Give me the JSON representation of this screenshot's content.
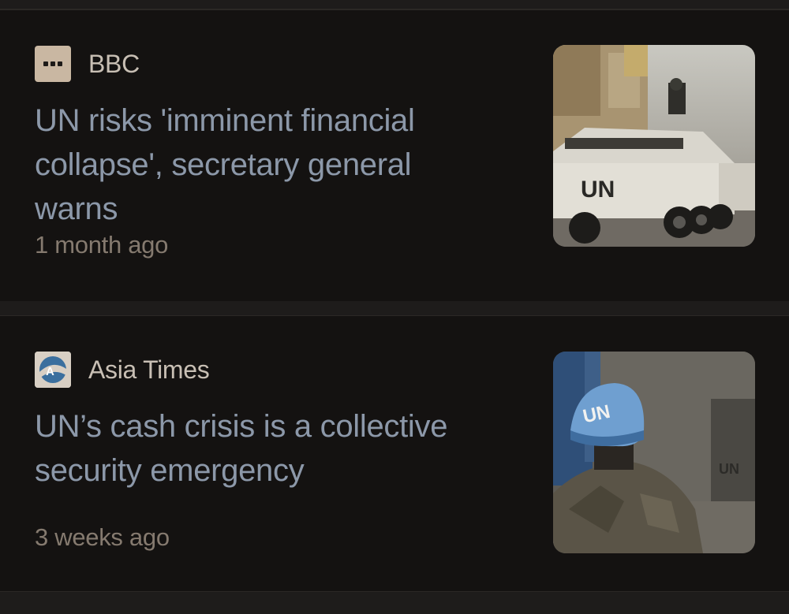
{
  "articles": [
    {
      "source": "BBC",
      "source_logo": "bbc-logo-icon",
      "headline": "UN risks 'imminent financial collapse', secretary general warns",
      "time": "1 month ago",
      "thumbnail": "un-armored-vehicle-image",
      "thumbnail_text": "UN"
    },
    {
      "source": "Asia Times",
      "source_logo": "asia-times-logo-icon",
      "headline": "UN’s cash crisis is a collective security emergency",
      "time": "3 weeks ago",
      "thumbnail": "un-peacekeeper-helmet-image",
      "thumbnail_text": "UN"
    }
  ],
  "colors": {
    "card_background": "#141211",
    "page_background": "#1e1c1b",
    "headline": "#8c98a9",
    "source": "#c8bfb4",
    "timestamp": "#857a6f"
  }
}
